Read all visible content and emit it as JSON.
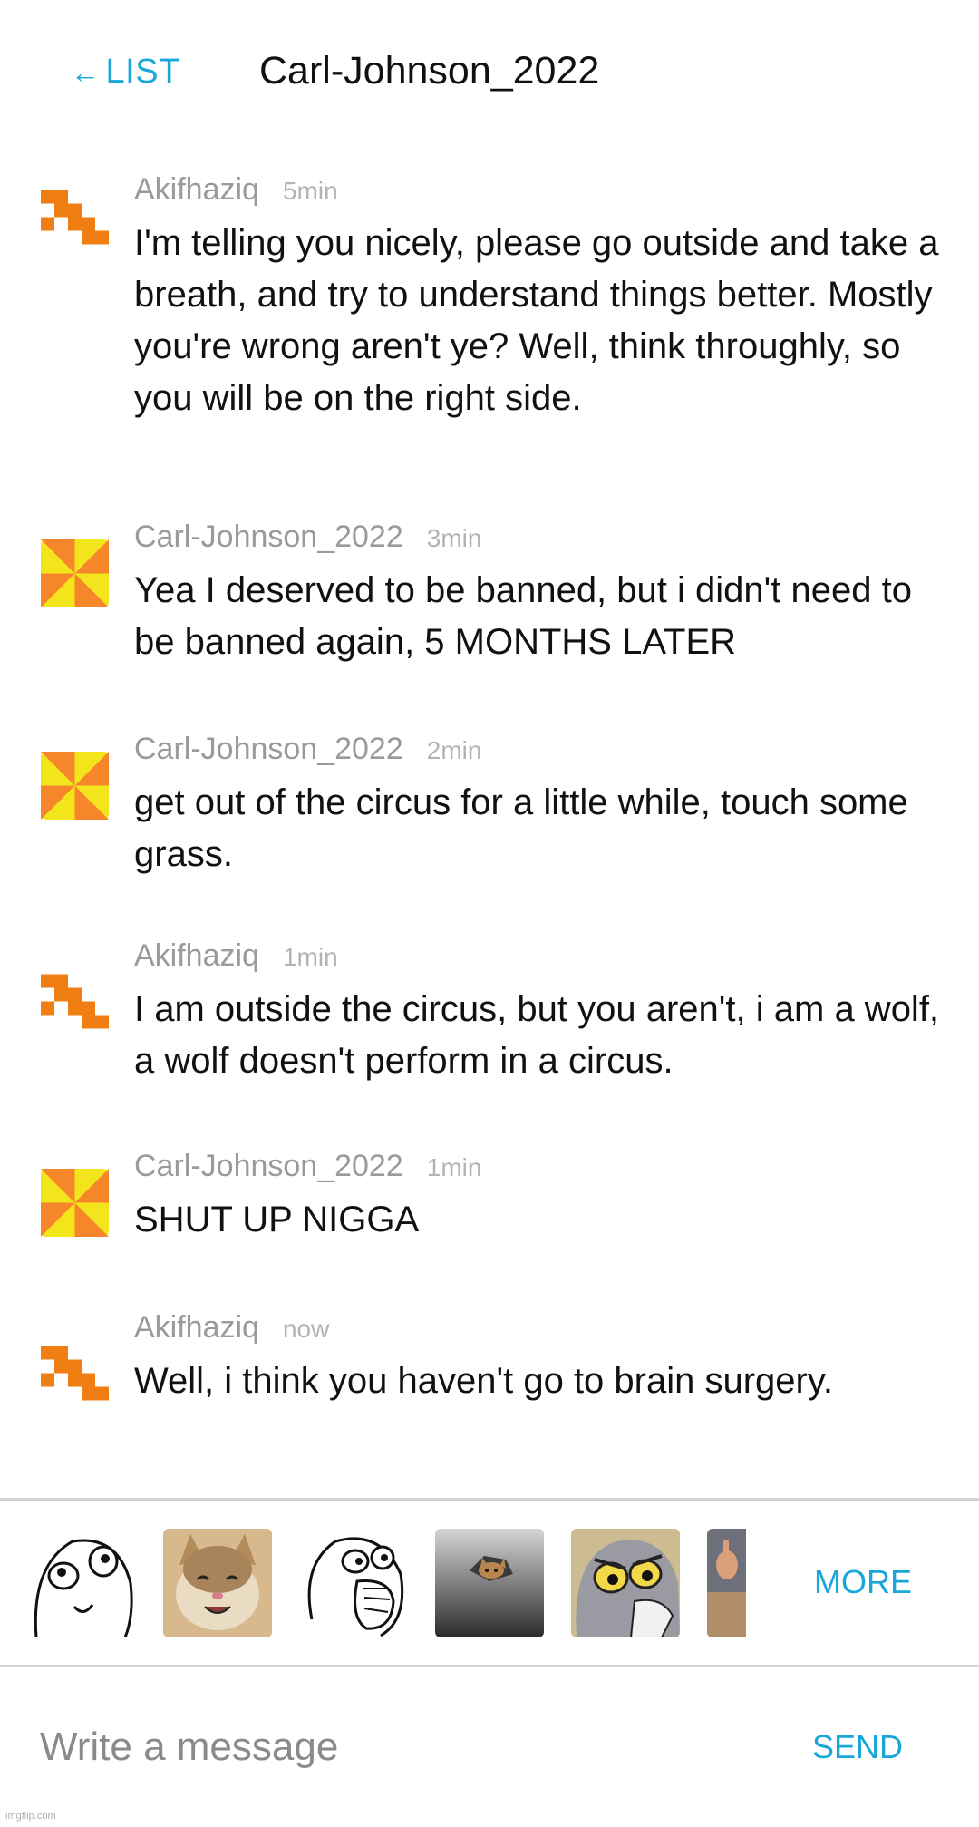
{
  "header": {
    "back_label": "LIST",
    "back_arrow": "←",
    "title": "Carl-Johnson_2022"
  },
  "messages": [
    {
      "author": "Akifhaziq",
      "time": "5min",
      "avatar": "pixel-wolf-avatar",
      "text": "I'm telling you nicely, please go outside and take a breath, and try to understand things better. Mostly you're wrong aren't ye? Well, think throughly, so you will be on the right side."
    },
    {
      "author": "Carl-Johnson_2022",
      "time": "3min",
      "avatar": "pinwheel-avatar",
      "text": "Yea I deserved to be banned, but i didn't need to be banned again, 5 MONTHS LATER"
    },
    {
      "author": "Carl-Johnson_2022",
      "time": "2min",
      "avatar": "pinwheel-avatar",
      "text": "get out of the circus for a little while, touch some grass."
    },
    {
      "author": "Akifhaziq",
      "time": "1min",
      "avatar": "pixel-wolf-avatar",
      "text": "I am outside the circus, but you aren't, i am a wolf, a wolf doesn't perform in a circus."
    },
    {
      "author": "Carl-Johnson_2022",
      "time": "1min",
      "avatar": "pinwheel-avatar",
      "text": "SHUT UP NIGGA"
    },
    {
      "author": "Akifhaziq",
      "time": "now",
      "avatar": "pixel-wolf-avatar",
      "text": "Well, i think you haven't go to brain surgery."
    }
  ],
  "memes": [
    {
      "name": "derp-rage-face"
    },
    {
      "name": "smiling-cat"
    },
    {
      "name": "lol-rage-face"
    },
    {
      "name": "ceiling-cat"
    },
    {
      "name": "unsettled-tom"
    },
    {
      "name": "pointing-man-partial"
    }
  ],
  "meme_bar": {
    "more_label": "MORE"
  },
  "compose": {
    "placeholder": "Write a message",
    "send_label": "SEND"
  },
  "watermark": "imgflip.com",
  "colors": {
    "accent": "#1aa6d9",
    "wolf_avatar": "#f07f13",
    "pinwheel_orange": "#f7862a",
    "pinwheel_yellow": "#f2e51c"
  }
}
